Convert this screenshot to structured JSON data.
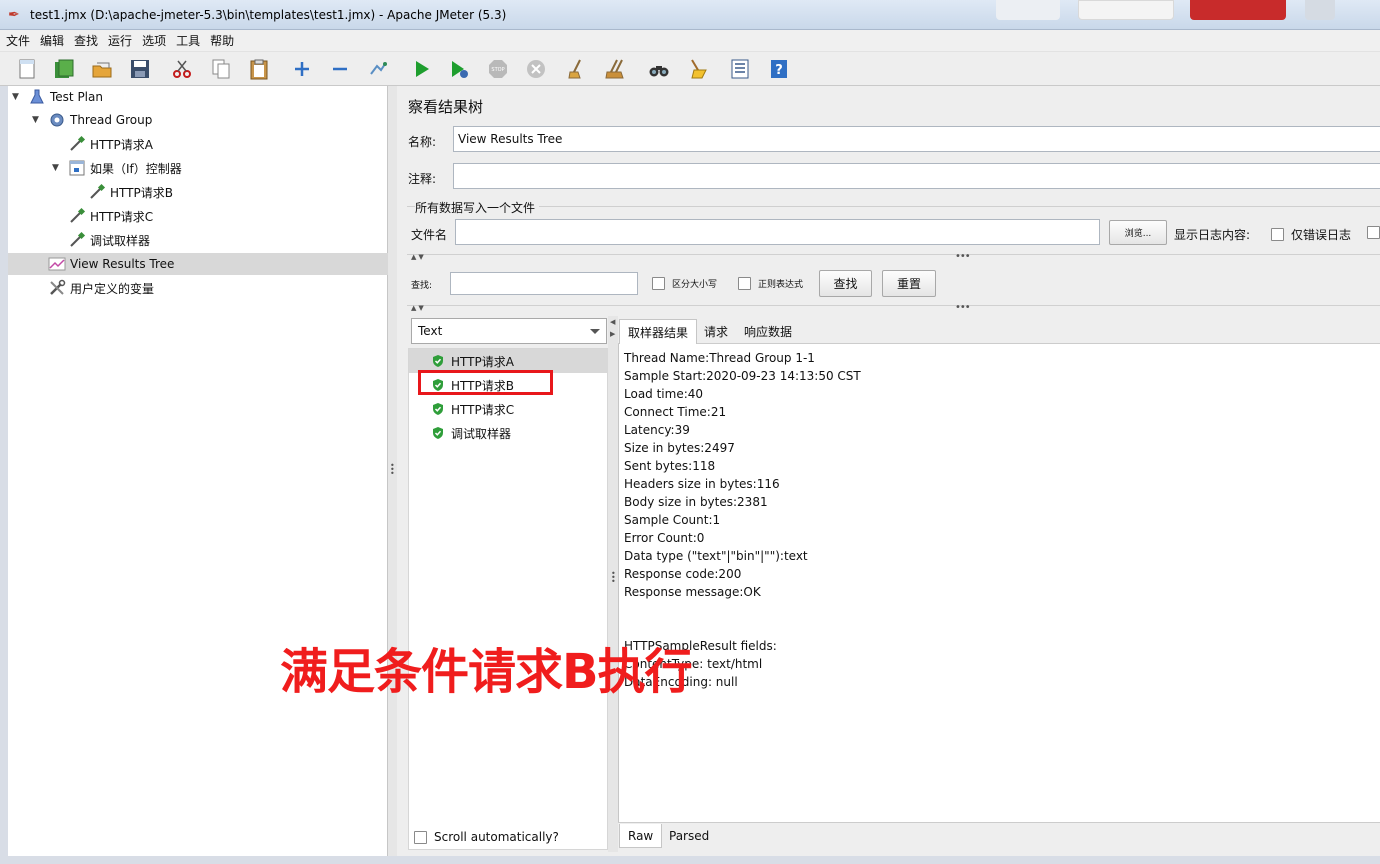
{
  "window": {
    "title": "test1.jmx (D:\\apache-jmeter-5.3\\bin\\templates\\test1.jmx) - Apache JMeter (5.3)"
  },
  "menu": [
    "文件",
    "编辑",
    "查找",
    "运行",
    "选项",
    "工具",
    "帮助"
  ],
  "toolbar": [
    "new-icon",
    "templates-icon",
    "open-icon",
    "save-icon",
    "cut-icon",
    "copy-icon",
    "paste-icon",
    "expand-icon",
    "collapse-icon",
    "toggle-icon",
    "start-icon",
    "start-no-pause-icon",
    "stop-icon",
    "shutdown-icon",
    "clear-icon",
    "clear-all-icon",
    "search-icon",
    "reset-search-icon",
    "function-helper-icon",
    "help-icon"
  ],
  "tree": {
    "test_plan": "Test Plan",
    "thread_group": "Thread Group",
    "http_a": "HTTP请求A",
    "if_controller": "如果（If）控制器",
    "http_b": "HTTP请求B",
    "http_c": "HTTP请求C",
    "debug_sampler": "调试取样器",
    "view_results_tree": "View Results Tree",
    "user_vars": "用户定义的变量"
  },
  "panel": {
    "title": "察看结果树",
    "name_label": "名称:",
    "name_value": "View Results Tree",
    "comment_label": "注释:",
    "comment_value": "",
    "file_group_title": "所有数据写入一个文件",
    "filename_label": "文件名",
    "filename_value": "",
    "browse_button": "浏览...",
    "log_content_label": "显示日志内容:",
    "errors_only_label": "仅错误日志",
    "search_label": "查找:",
    "search_value": "",
    "case_sensitive_label": "区分大小写",
    "regex_label": "正则表达式",
    "search_button": "查找",
    "reset_button": "重置"
  },
  "results": {
    "renderer": "Text",
    "items": [
      "HTTP请求A",
      "HTTP请求B",
      "HTTP请求C",
      "调试取样器"
    ],
    "scroll_auto_label": "Scroll automatically?"
  },
  "tabs": [
    "取样器结果",
    "请求",
    "响应数据"
  ],
  "detail_lines": [
    "Thread Name:Thread Group 1-1",
    "Sample Start:2020-09-23 14:13:50 CST",
    "Load time:40",
    "Connect Time:21",
    "Latency:39",
    "Size in bytes:2497",
    "Sent bytes:118",
    "Headers size in bytes:116",
    "Body size in bytes:2381",
    "Sample Count:1",
    "Error Count:0",
    "Data type (\"text\"|\"bin\"|\"\"):text",
    "Response code:200",
    "Response message:OK",
    "",
    "",
    "HTTPSampleResult fields:",
    "ContentType: text/html",
    "DataEncoding: null"
  ],
  "bottom_tabs": [
    "Raw",
    "Parsed"
  ],
  "annotation": {
    "text": "满足条件请求B执行"
  },
  "colors": {
    "annotation": "#f01d1d",
    "success_shield": "#2f9e3a",
    "selection": "#d8d8d8"
  }
}
